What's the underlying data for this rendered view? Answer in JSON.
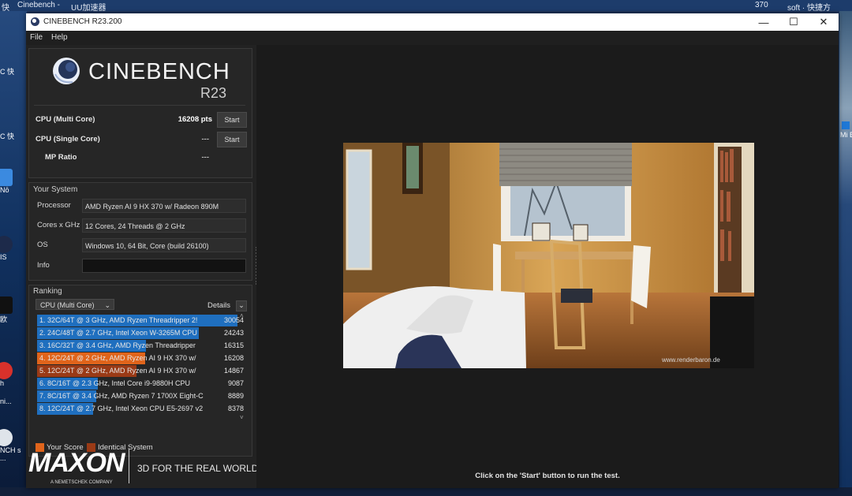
{
  "desktop": {
    "top_items": [
      "快",
      "Cinebench -",
      "UU加速器",
      "370",
      "soft · 快捷方"
    ],
    "left_icons": [
      "C 快",
      "C 快",
      "Nō",
      "IS",
      "欧",
      "h",
      "ni...",
      "NCH s ..."
    ],
    "left_icons_2": [
      "W"
    ],
    "right_icons": [
      "Mi E"
    ]
  },
  "window": {
    "title": "CINEBENCH R23.200",
    "controls": {
      "minimize": "—",
      "maximize": "☐",
      "close": "✕"
    }
  },
  "menu": [
    "File",
    "Help"
  ],
  "logo": {
    "brand": "CINEBENCH",
    "version": "R23"
  },
  "tests": [
    {
      "label": "CPU (Multi Core)",
      "value": "16208 pts",
      "button": "Start"
    },
    {
      "label": "CPU (Single Core)",
      "value": "---",
      "button": "Start"
    },
    {
      "label": "MP Ratio",
      "value": "---"
    }
  ],
  "your_system": {
    "title": "Your System",
    "fields": [
      {
        "label": "Processor",
        "value": "AMD Ryzen AI 9 HX 370 w/ Radeon 890M"
      },
      {
        "label": "Cores x GHz",
        "value": "12 Cores, 24 Threads @ 2 GHz"
      },
      {
        "label": "OS",
        "value": "Windows 10, 64 Bit, Core (build 26100)"
      },
      {
        "label": "Info",
        "value": ""
      }
    ]
  },
  "ranking": {
    "title": "Ranking",
    "dropdown": "CPU (Multi Core)",
    "details": "Details",
    "max_score": 30054,
    "rows": [
      {
        "label": "1. 32C/64T @ 3 GHz, AMD Ryzen Threadripper 2!",
        "score": "30054",
        "value": 30054,
        "kind": "ref"
      },
      {
        "label": "2. 24C/48T @ 2.7 GHz, Intel Xeon W-3265M CPU",
        "score": "24243",
        "value": 24243,
        "kind": "ref"
      },
      {
        "label": "3. 16C/32T @ 3.4 GHz, AMD Ryzen Threadripper",
        "score": "16315",
        "value": 16315,
        "kind": "ref"
      },
      {
        "label": "4. 12C/24T @ 2 GHz, AMD Ryzen AI 9 HX 370 w/",
        "score": "16208",
        "value": 16208,
        "kind": "yours"
      },
      {
        "label": "5. 12C/24T @ 2 GHz, AMD Ryzen AI 9 HX 370 w/",
        "score": "14867",
        "value": 14867,
        "kind": "identical"
      },
      {
        "label": "6. 8C/16T @ 2.3 GHz, Intel Core i9-9880H CPU",
        "score": "9087",
        "value": 9087,
        "kind": "ref"
      },
      {
        "label": "7. 8C/16T @ 3.4 GHz, AMD Ryzen 7 1700X Eight-C",
        "score": "8889",
        "value": 8889,
        "kind": "ref"
      },
      {
        "label": "8. 12C/24T @ 2.7 GHz, Intel Xeon CPU E5-2697 v2",
        "score": "8378",
        "value": 8378,
        "kind": "ref"
      }
    ],
    "legend": [
      {
        "label": "Your Score",
        "color": "#e0641b"
      },
      {
        "label": "Identical System",
        "color": "#9a3a16"
      }
    ]
  },
  "colors": {
    "ref_bar": "#1f6fbf",
    "yours_bar": "#e0641b",
    "identical_bar": "#9a3a16"
  },
  "footer": {
    "brand": "MAXON",
    "sub": "A NEMETSCHEK COMPANY",
    "tagline": "3D FOR THE REAL WORLD"
  },
  "render": {
    "watermark": "www.renderbaron.de"
  },
  "status": "Click on the 'Start' button to run the test."
}
